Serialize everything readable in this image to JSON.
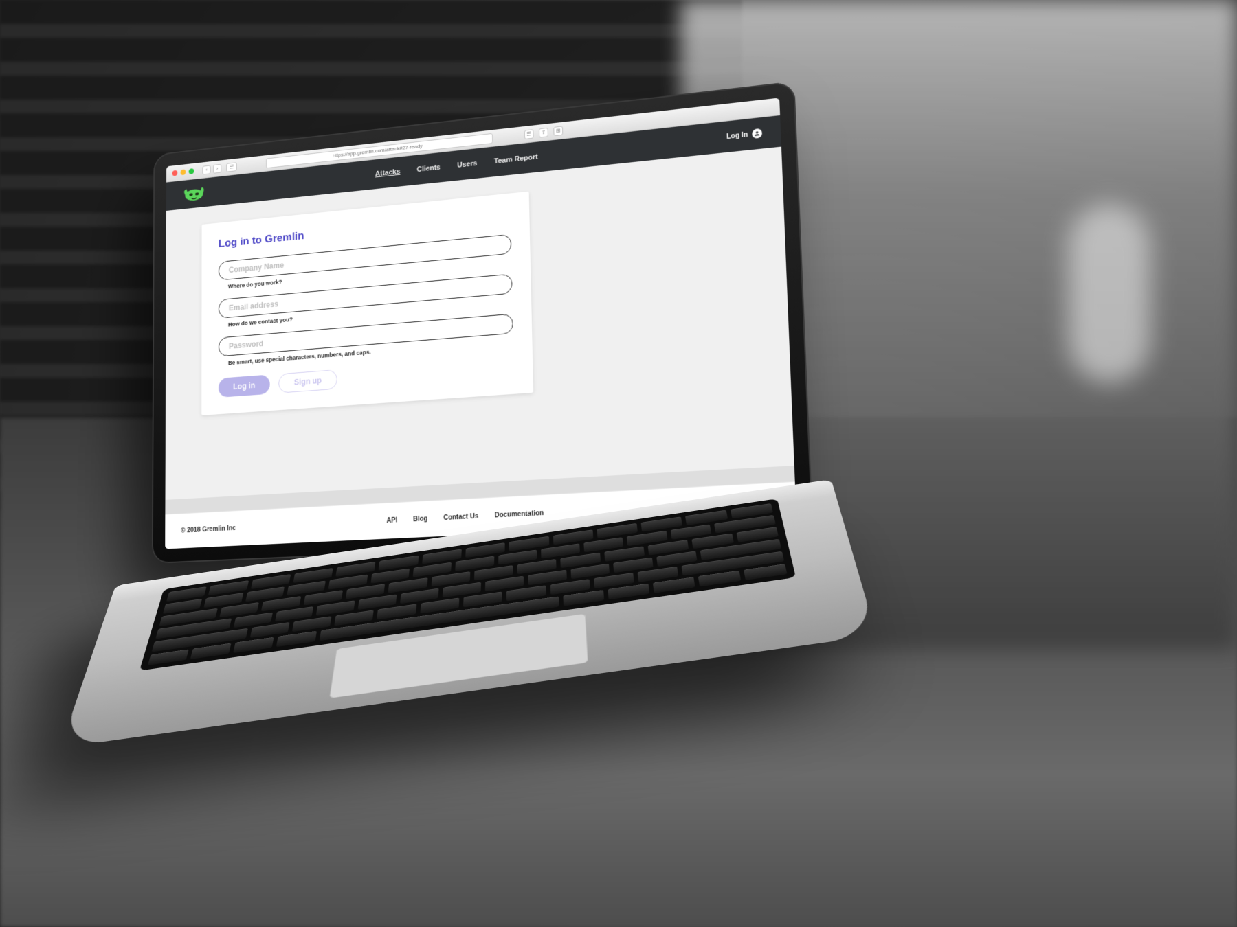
{
  "browser": {
    "url": "https://app.gremlin.com/attack#27-ready"
  },
  "topbar": {
    "nav": {
      "attacks": "Attacks",
      "clients": "Clients",
      "users": "Users",
      "team_report": "Team Report",
      "active": "attacks"
    },
    "login_label": "Log In"
  },
  "login_card": {
    "title": "Log in to Gremlin",
    "company": {
      "placeholder": "Company Name",
      "hint": "Where do you work?"
    },
    "email": {
      "placeholder": "Email address",
      "hint": "How do we contact you?"
    },
    "password": {
      "placeholder": "Password",
      "hint": "Be smart, use special characters, numbers, and caps."
    },
    "login_button": "Log in",
    "signup_button": "Sign up"
  },
  "footer": {
    "copyright": "© 2018 Gremlin Inc",
    "links": {
      "api": "API",
      "blog": "Blog",
      "contact": "Contact Us",
      "docs": "Documentation"
    }
  },
  "colors": {
    "brand_purple": "#4b45c6",
    "brand_green": "#5BD65B",
    "topbar_bg": "#2e3134"
  }
}
